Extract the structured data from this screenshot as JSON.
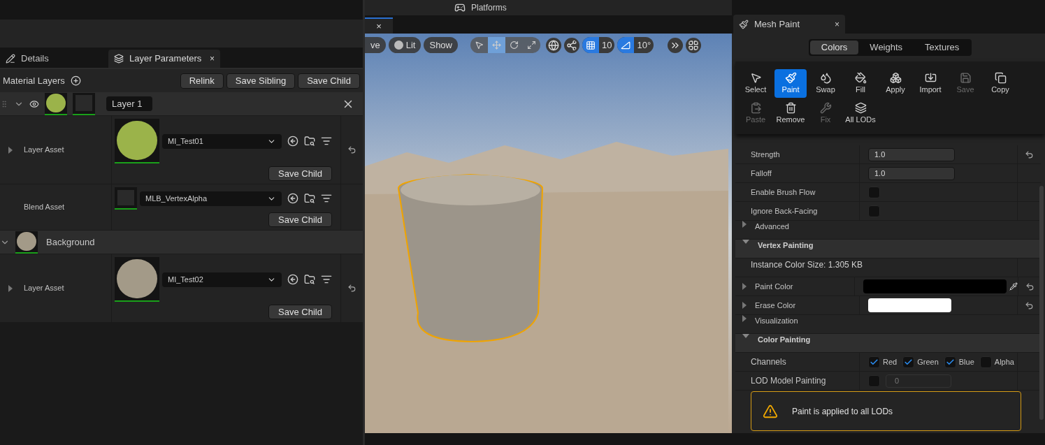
{
  "left_panel": {
    "tabs": [
      {
        "label": "Details",
        "selected": false
      },
      {
        "label": "Layer Parameters",
        "selected": true,
        "close": "×"
      }
    ],
    "toolbar": {
      "title": "Material Layers",
      "buttons": [
        "Relink",
        "Save Sibling",
        "Save Child"
      ]
    },
    "layers": [
      {
        "kind": "layer",
        "name": "Layer 1",
        "expanded": true,
        "visible": true,
        "rows": [
          {
            "label": "Layer Asset",
            "asset": "MI_Test01",
            "kind": "moss",
            "button": "Save Child",
            "expandable": true,
            "reset": true
          },
          {
            "label": "Blend Asset",
            "asset": "MLB_VertexAlpha",
            "kind": "dark",
            "button": "Save Child",
            "expandable": false,
            "reset": false
          }
        ]
      },
      {
        "kind": "base",
        "name": "Background",
        "expanded": true,
        "visible": false,
        "rows": [
          {
            "label": "Layer Asset",
            "asset": "MI_Test02",
            "kind": "stone",
            "button": "Save Child",
            "expandable": true,
            "reset": true
          }
        ]
      }
    ]
  },
  "viewport": {
    "top_menu": "Platforms",
    "tab_close": "×",
    "view_buttons": [
      {
        "label": "ve",
        "kind": "text"
      },
      {
        "label": "Lit",
        "kind": "lit"
      },
      {
        "label": "Show",
        "kind": "text"
      }
    ],
    "transform_tools": [
      {
        "kind": "select",
        "selected": false
      },
      {
        "kind": "move",
        "selected": true
      },
      {
        "kind": "rotate",
        "selected": false
      },
      {
        "kind": "scale",
        "selected": false
      }
    ],
    "grid_snap": {
      "on": true,
      "value": "10"
    },
    "angle_snap": {
      "on": true,
      "value": "10°"
    }
  },
  "mesh_paint": {
    "tab": {
      "title": "Mesh Paint",
      "close": "×"
    },
    "modes": [
      {
        "label": "Colors",
        "selected": true
      },
      {
        "label": "Weights",
        "selected": false
      },
      {
        "label": "Textures",
        "selected": false
      }
    ],
    "tools": [
      {
        "kind": "select",
        "label": "Select",
        "selected": false,
        "disabled": false
      },
      {
        "kind": "paint",
        "label": "Paint",
        "selected": true,
        "disabled": false
      },
      {
        "kind": "swap",
        "label": "Swap",
        "selected": false,
        "disabled": false
      },
      {
        "kind": "fill",
        "label": "Fill",
        "selected": false,
        "disabled": false
      },
      {
        "kind": "apply",
        "label": "Apply",
        "selected": false,
        "disabled": false
      },
      {
        "kind": "import",
        "label": "Import",
        "selected": false,
        "disabled": false
      },
      {
        "kind": "save",
        "label": "Save",
        "selected": false,
        "disabled": true
      },
      {
        "kind": "copy",
        "label": "Copy",
        "selected": false,
        "disabled": false
      },
      {
        "kind": "paste",
        "label": "Paste",
        "selected": false,
        "disabled": true
      },
      {
        "kind": "remove",
        "label": "Remove",
        "selected": false,
        "disabled": false
      },
      {
        "kind": "fix",
        "label": "Fix",
        "selected": false,
        "disabled": true
      },
      {
        "kind": "lods",
        "label": "All LODs",
        "selected": false,
        "disabled": false
      }
    ],
    "properties": [
      {
        "kind": "number",
        "label": "Strength",
        "value": "1.0",
        "reset": true
      },
      {
        "kind": "number",
        "label": "Falloff",
        "value": "1.0",
        "reset": false
      },
      {
        "kind": "checkbox",
        "label": "Enable Brush Flow",
        "checked": false
      },
      {
        "kind": "checkbox",
        "label": "Ignore Back-Facing",
        "checked": false
      },
      {
        "kind": "category",
        "label": "Advanced",
        "expanded": false
      },
      {
        "kind": "section",
        "label": "Vertex Painting",
        "expanded": true
      },
      {
        "kind": "info",
        "label": "Instance Color Size: 1.305 KB"
      },
      {
        "kind": "color",
        "label": "Paint Color",
        "color": "#000000",
        "eyedropper": true,
        "reset": true
      },
      {
        "kind": "color",
        "label": "Erase Color",
        "color": "#ffffff",
        "eyedropper": false,
        "reset": true
      },
      {
        "kind": "category",
        "label": "Visualization",
        "expanded": false
      },
      {
        "kind": "section",
        "label": "Color Painting",
        "expanded": true
      },
      {
        "kind": "channels",
        "label": "Channels",
        "channels": [
          {
            "label": "Red",
            "checked": true
          },
          {
            "label": "Green",
            "checked": true
          },
          {
            "label": "Blue",
            "checked": true
          },
          {
            "label": "Alpha",
            "checked": false
          }
        ]
      },
      {
        "kind": "lod",
        "label": "LOD Model Painting",
        "checked": false,
        "value": "0",
        "disabled": true
      },
      {
        "kind": "warning",
        "label": "Paint is applied to all LODs"
      }
    ]
  }
}
